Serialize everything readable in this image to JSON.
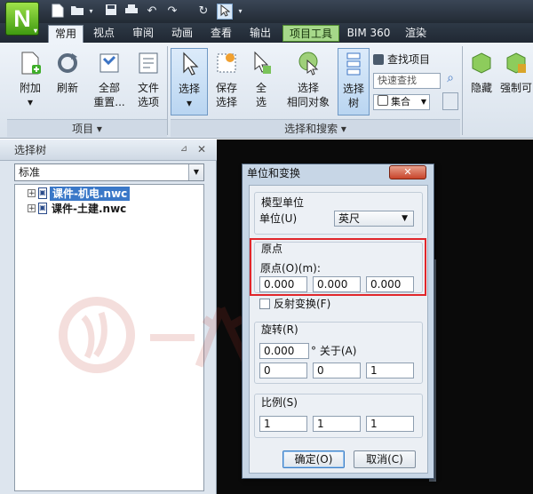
{
  "app": {
    "logo_letter": "N"
  },
  "quick_access": {
    "icons": [
      "new-file-icon",
      "open-folder-icon",
      "save-icon",
      "print-icon",
      "undo-icon",
      "redo-icon",
      "refresh-icon",
      "select-cursor-icon"
    ]
  },
  "tabs": [
    {
      "label": "常用",
      "active": true
    },
    {
      "label": "视点"
    },
    {
      "label": "审阅"
    },
    {
      "label": "动画"
    },
    {
      "label": "查看"
    },
    {
      "label": "输出"
    },
    {
      "label": "项目工具",
      "contextual": true
    },
    {
      "label": "BIM 360"
    },
    {
      "label": "渲染"
    }
  ],
  "ribbon": {
    "project_group": {
      "label": "项目",
      "buttons": [
        {
          "line1": "附加",
          "line2": "▾"
        },
        {
          "line1": "刷新"
        },
        {
          "line1": "全部",
          "line2": "重置..."
        },
        {
          "line1": "文件",
          "line2": "选项"
        }
      ]
    },
    "select_group": {
      "label": "选择和搜索",
      "buttons": [
        {
          "line1": "选择",
          "line2": "▾"
        },
        {
          "line1": "保存",
          "line2": "选择"
        },
        {
          "line1": "全",
          "line2": "选"
        },
        {
          "line1": "选择",
          "line2": "相同对象"
        },
        {
          "line1": "选择",
          "line2": "树"
        }
      ],
      "find_items": "查找项目",
      "quick_find_placeholder": "快速查找",
      "set_label": "集合"
    },
    "visibility_group": {
      "hide": "隐藏",
      "require": "强制可"
    }
  },
  "selection_tree": {
    "title": "选择树",
    "mode": "标准",
    "items": [
      {
        "label": "课件-机电.nwc",
        "selected": true
      },
      {
        "label": "课件-土建.nwc",
        "selected": false
      }
    ]
  },
  "dialog": {
    "title": "单位和变换",
    "close": "✕",
    "model_units": {
      "label": "模型单位",
      "units_label": "单位(U)",
      "units_value": "英尺"
    },
    "origin": {
      "label": "原点",
      "sub_label": "原点(O)(m):",
      "x": "0.000",
      "y": "0.000",
      "z": "0.000"
    },
    "reflect_label": "反射变换(F)",
    "rotation": {
      "label": "旋转(R)",
      "angle": "0.000",
      "about_label": "° 关于(A)",
      "ax": "0",
      "ay": "0",
      "az": "1"
    },
    "scale": {
      "label": "比例(S)",
      "x": "1",
      "y": "1",
      "z": "1"
    },
    "ok": "确定(O)",
    "cancel": "取消(C)"
  },
  "colors": {
    "highlight_box": "#e0262b",
    "selected_tree_item": "#3a78c8",
    "viewport": "#0a0a0a"
  }
}
